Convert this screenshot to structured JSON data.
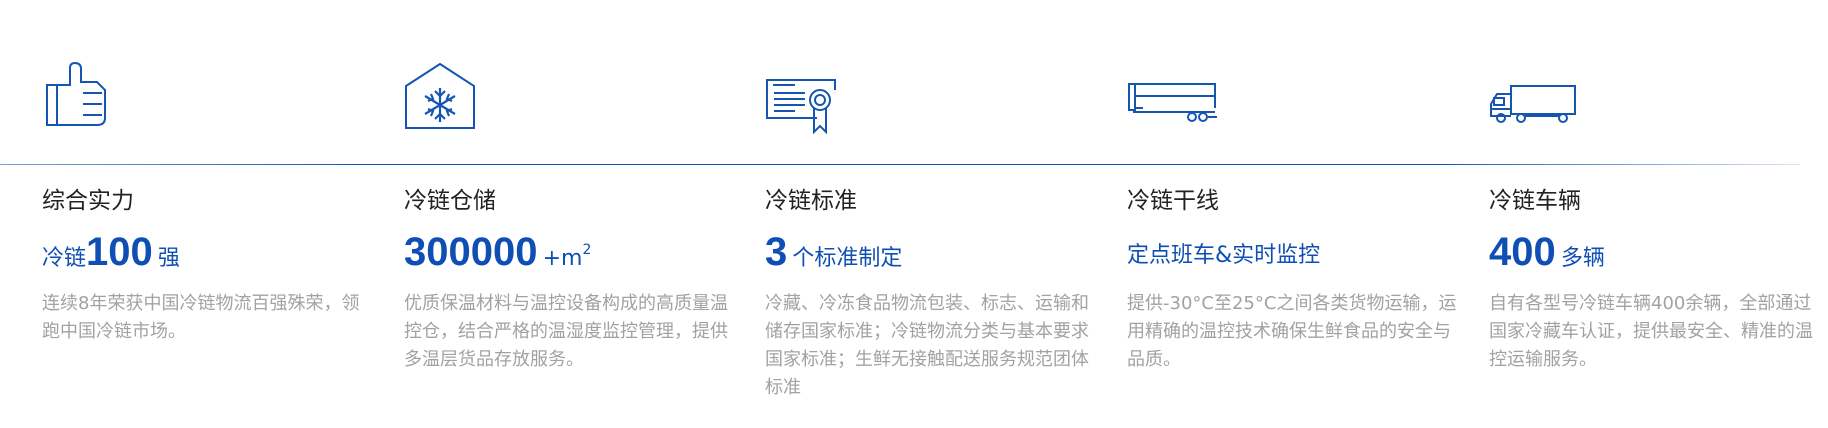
{
  "features": [
    {
      "icon": "thumbs-up-icon",
      "title": "综合实力",
      "stat_prefix": "冷链",
      "stat_number": "100",
      "stat_suffix": "强",
      "description": "连续8年荣获中国冷链物流百强殊荣，领跑中国冷链市场。"
    },
    {
      "icon": "cold-storage-icon",
      "title": "冷链仓储",
      "stat_number": "300000",
      "stat_suffix_plus": "+m",
      "stat_suffix_sup": "2",
      "description": "优质保温材料与温控设备构成的高质量温控仓，结合严格的温湿度监控管理，提供多温层货品存放服务。"
    },
    {
      "icon": "certificate-icon",
      "title": "冷链标准",
      "stat_number": "3",
      "stat_suffix": "个标准制定",
      "description": "冷藏、冷冻食品物流包装、标志、运输和储存国家标准；冷链物流分类与基本要求国家标准；生鲜无接触配送服务规范团体标准"
    },
    {
      "icon": "trailer-icon",
      "title": "冷链干线",
      "stat_text": "定点班车&实时监控",
      "description": "提供-30°C至25°C之间各类货物运输，运用精确的温控技术确保生鲜食品的安全与品质。"
    },
    {
      "icon": "truck-icon",
      "title": "冷链车辆",
      "stat_number": "400",
      "stat_suffix": "多辆",
      "description": "自有各型号冷链车辆400余辆，全部通过国家冷藏车认证，提供最安全、精准的温控运输服务。"
    }
  ],
  "colors": {
    "accent": "#0f4fb5",
    "icon_stroke": "#1556b3",
    "title": "#222222",
    "description": "#a2a2a2"
  }
}
